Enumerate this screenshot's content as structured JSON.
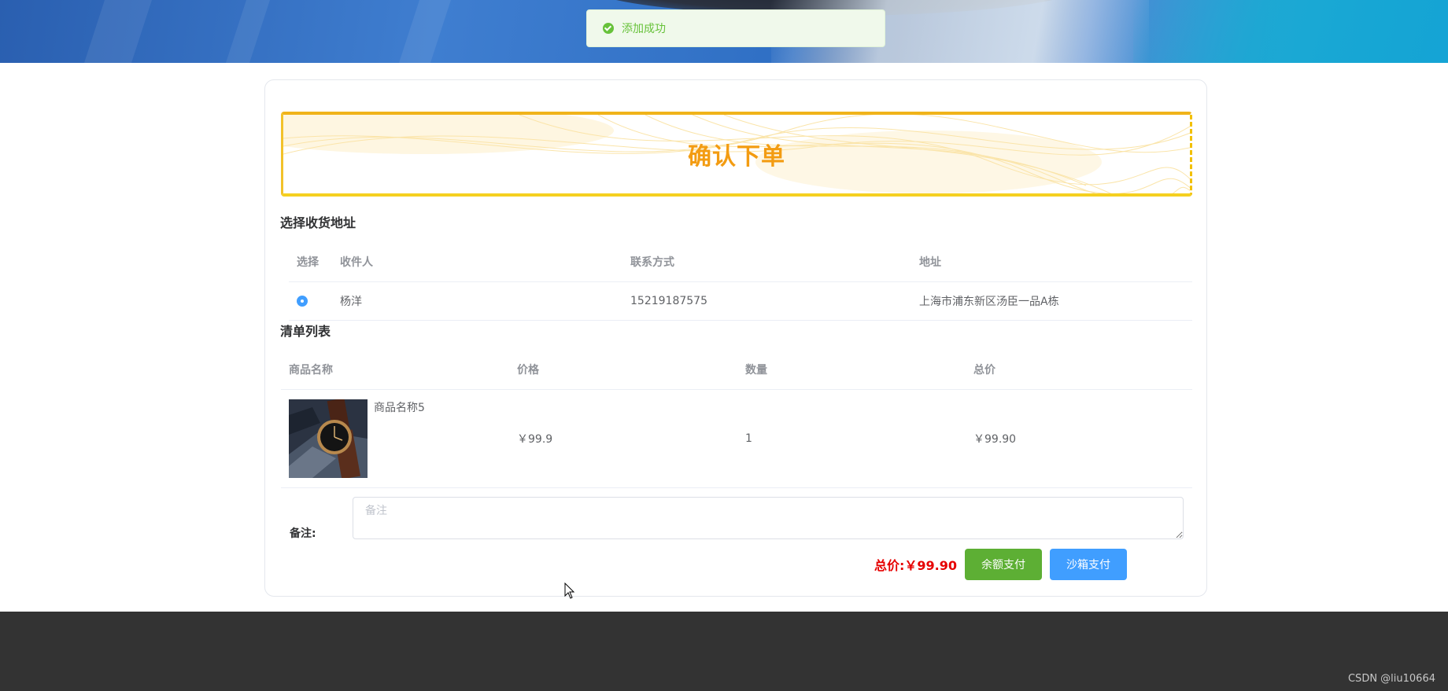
{
  "toast": {
    "message": "添加成功",
    "icon": "check-circle-icon"
  },
  "page": {
    "title": "确认下单"
  },
  "address": {
    "section_title": "选择收货地址",
    "columns": [
      "选择",
      "收件人",
      "联系方式",
      "地址"
    ],
    "rows": [
      {
        "selected": true,
        "name": "杨洋",
        "phone": "15219187575",
        "address": "上海市浦东新区汤臣一品A栋"
      }
    ]
  },
  "order": {
    "section_title": "清单列表",
    "columns": [
      "商品名称",
      "价格",
      "数量",
      "总价"
    ],
    "rows": [
      {
        "product_name": "商品名称5",
        "price": "￥99.9",
        "quantity": "1",
        "subtotal": "￥99.90"
      }
    ]
  },
  "note": {
    "label": "备注:",
    "placeholder": "备注",
    "value": ""
  },
  "summary": {
    "total_label": "总价:",
    "total_value": "￥99.90"
  },
  "actions": {
    "balance_pay": "余额支付",
    "sandbox_pay": "沙箱支付"
  },
  "footer": {
    "watermark": "CSDN @liu10664"
  },
  "colors": {
    "accent_orange": "#f39c12",
    "success_green": "#5daf34",
    "primary_blue": "#409eff",
    "price_red": "#e60000",
    "footer_bg": "#333333"
  }
}
